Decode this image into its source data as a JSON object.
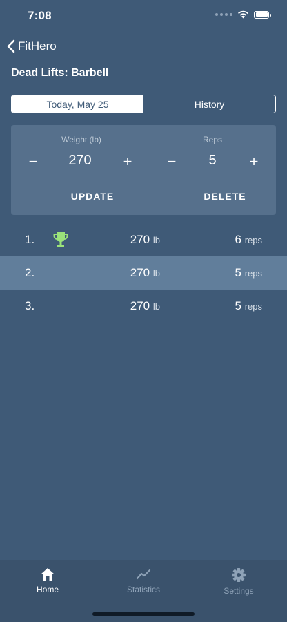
{
  "status_bar": {
    "time": "7:08"
  },
  "nav": {
    "back_label": "FitHero"
  },
  "page": {
    "title": "Dead Lifts: Barbell"
  },
  "segmented": {
    "tabs": [
      {
        "label": "Today, May 25",
        "active": true
      },
      {
        "label": "History",
        "active": false
      }
    ]
  },
  "editor": {
    "weight_label": "Weight (lb)",
    "weight_value": "270",
    "reps_label": "Reps",
    "reps_value": "5",
    "minus": "−",
    "plus": "+",
    "update_label": "UPDATE",
    "delete_label": "DELETE"
  },
  "sets": [
    {
      "number": "1.",
      "weight": "270",
      "weight_unit": "lb",
      "reps": "6",
      "reps_unit": "reps",
      "trophy": true,
      "selected": false
    },
    {
      "number": "2.",
      "weight": "270",
      "weight_unit": "lb",
      "reps": "5",
      "reps_unit": "reps",
      "trophy": false,
      "selected": true
    },
    {
      "number": "3.",
      "weight": "270",
      "weight_unit": "lb",
      "reps": "5",
      "reps_unit": "reps",
      "trophy": false,
      "selected": false
    }
  ],
  "tabbar": {
    "items": [
      {
        "label": "Home",
        "icon": "home-icon",
        "active": true
      },
      {
        "label": "Statistics",
        "icon": "statistics-icon",
        "active": false
      },
      {
        "label": "Settings",
        "icon": "gear-icon",
        "active": false
      }
    ]
  },
  "colors": {
    "background": "#3f5a77",
    "card": "#56708c",
    "selected_row": "#617e9b",
    "trophy": "#9be37a"
  }
}
